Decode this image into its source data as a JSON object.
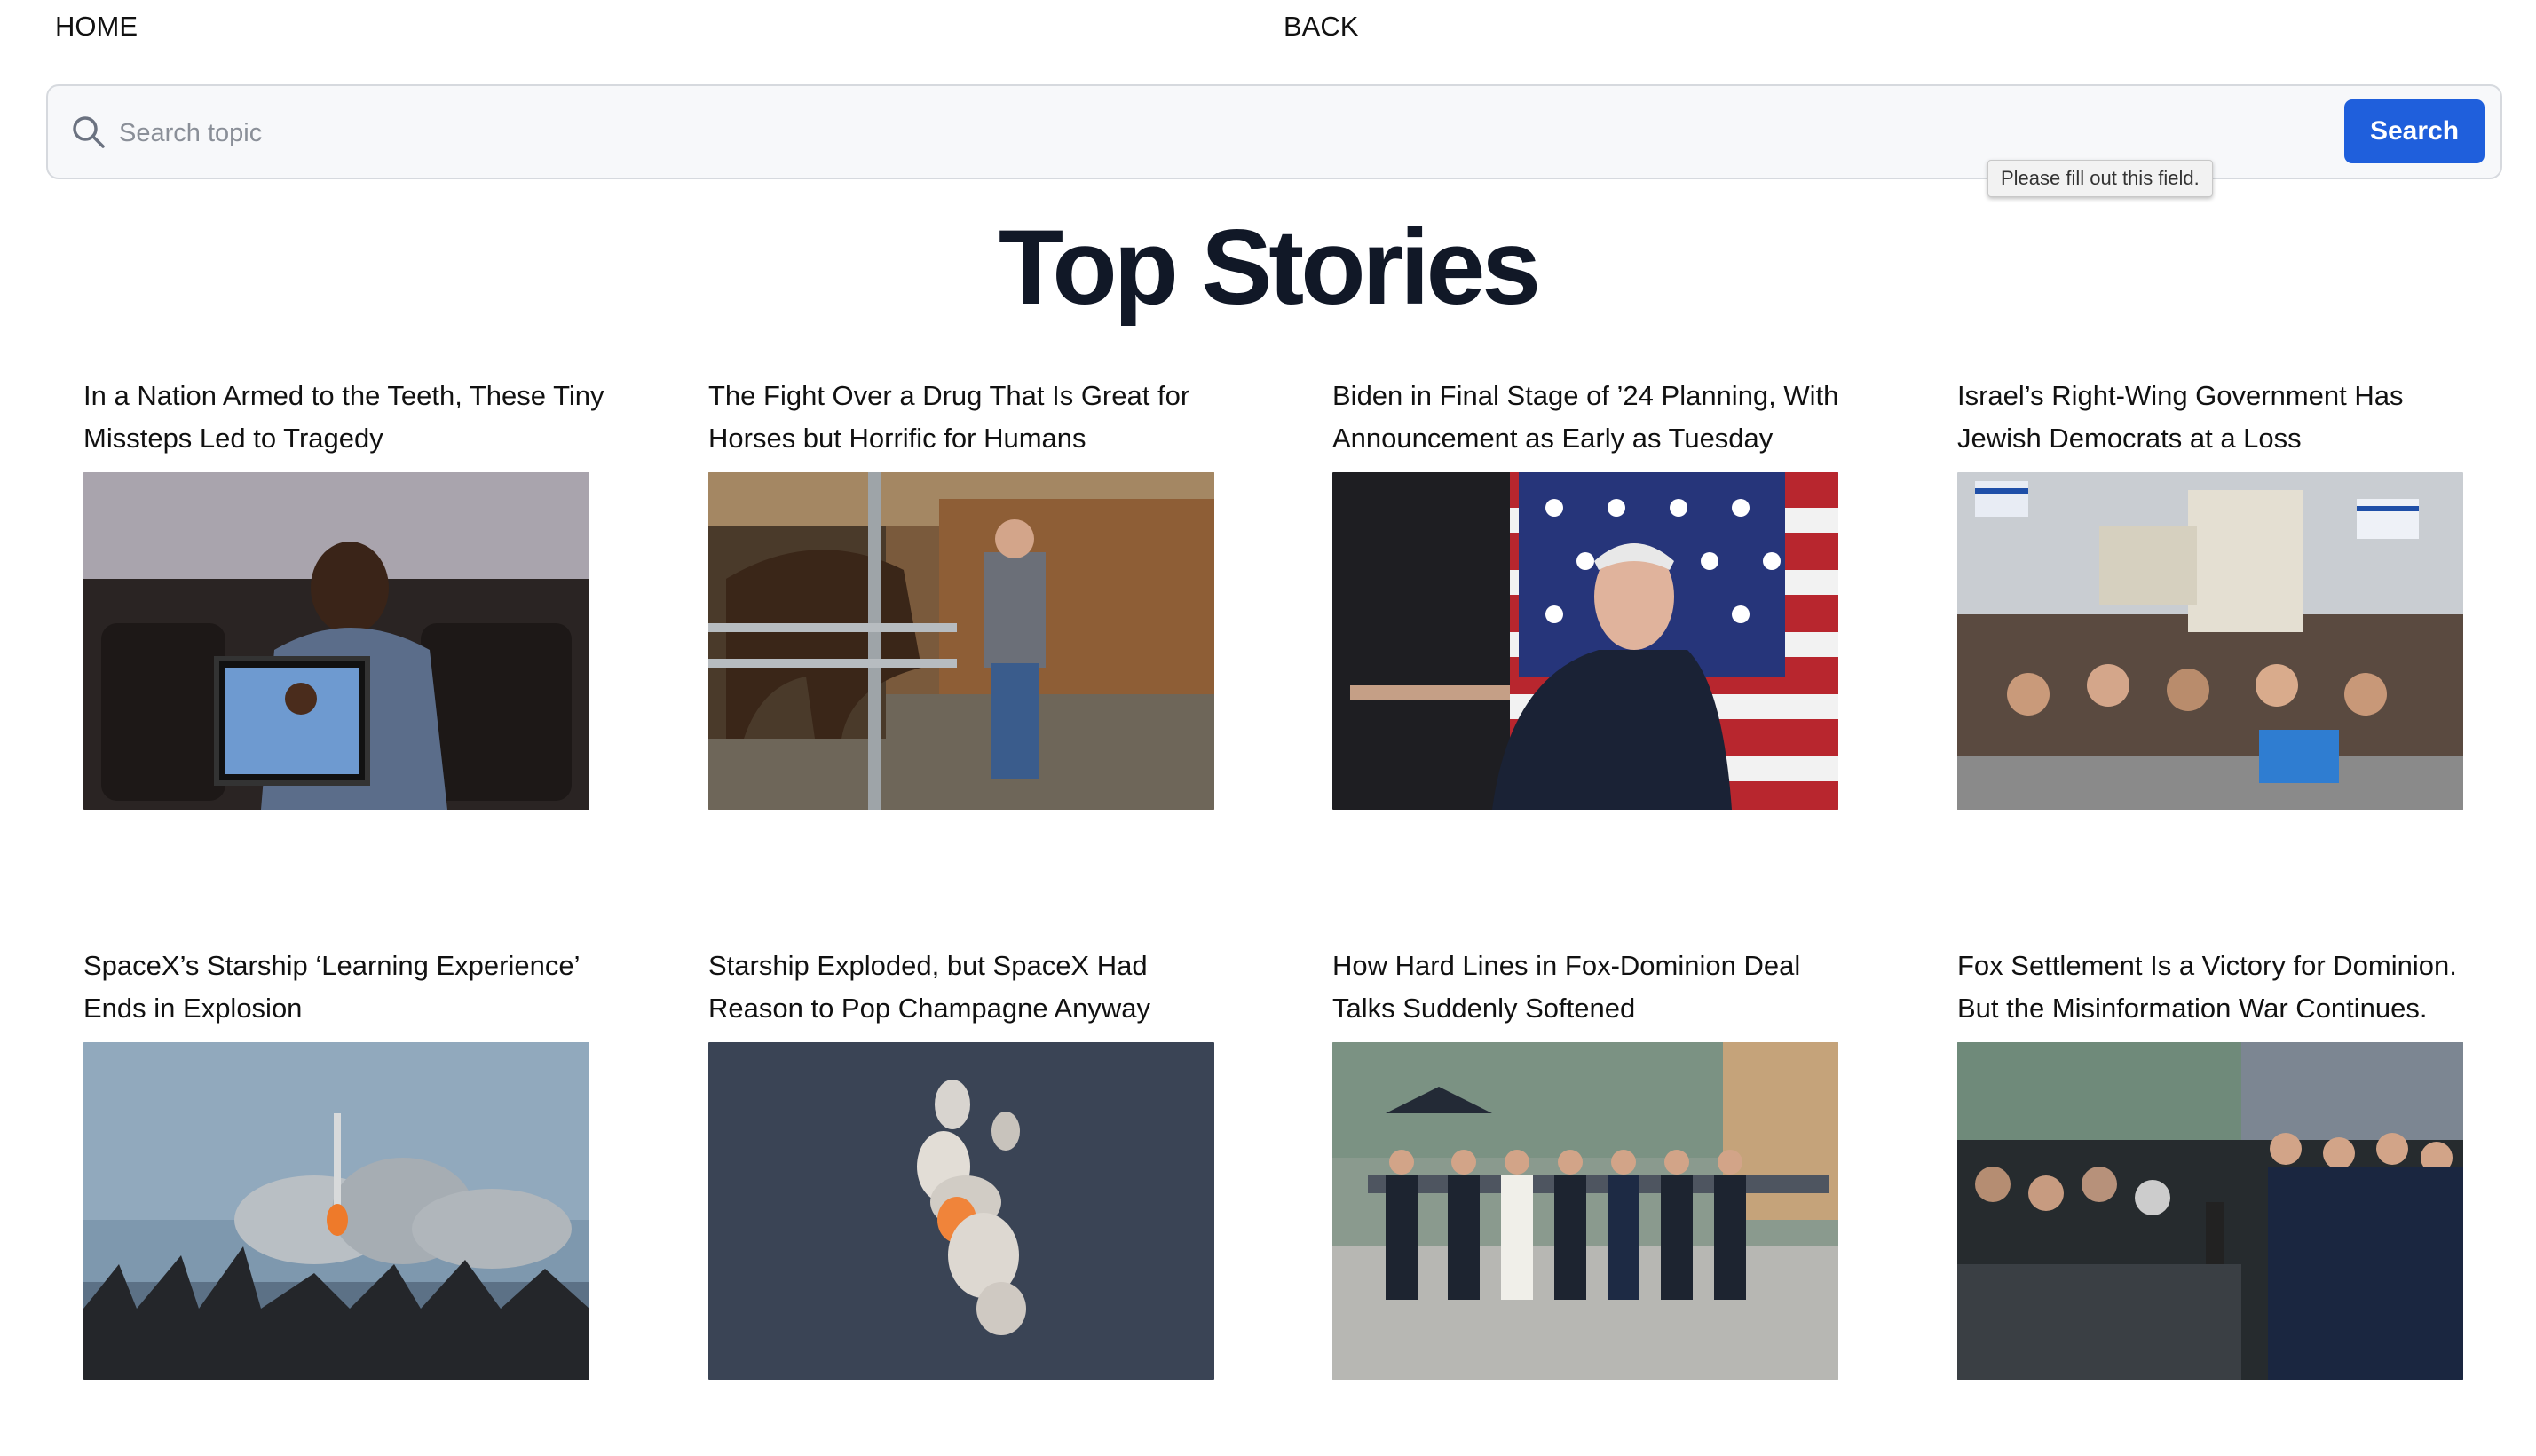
{
  "nav": {
    "home_label": "HOME",
    "back_label": "BACK"
  },
  "search": {
    "placeholder": "Search topic",
    "button_label": "Search",
    "validation_message": "Please fill out this field."
  },
  "page": {
    "title": "Top Stories"
  },
  "stories": [
    {
      "title": "In a Nation Armed to the Teeth, These Tiny Missteps Led to Tragedy"
    },
    {
      "title": "The Fight Over a Drug That Is Great for Horses but Horrific for Humans"
    },
    {
      "title": "Biden in Final Stage of ’24 Planning, With Announcement as Early as Tuesday"
    },
    {
      "title": "Israel’s Right-Wing Government Has Jewish Democrats at a Loss"
    },
    {
      "title": "SpaceX’s Starship ‘Learning Experience’ Ends in Explosion"
    },
    {
      "title": "Starship Exploded, but SpaceX Had Reason to Pop Champagne Anyway"
    },
    {
      "title": "How Hard Lines in Fox-Dominion Deal Talks Suddenly Softened"
    },
    {
      "title": "Fox Settlement Is a Victory for Dominion. But the Misinformation War Continues."
    }
  ],
  "colors": {
    "accent": "#1f5fdc",
    "title": "#111827"
  }
}
